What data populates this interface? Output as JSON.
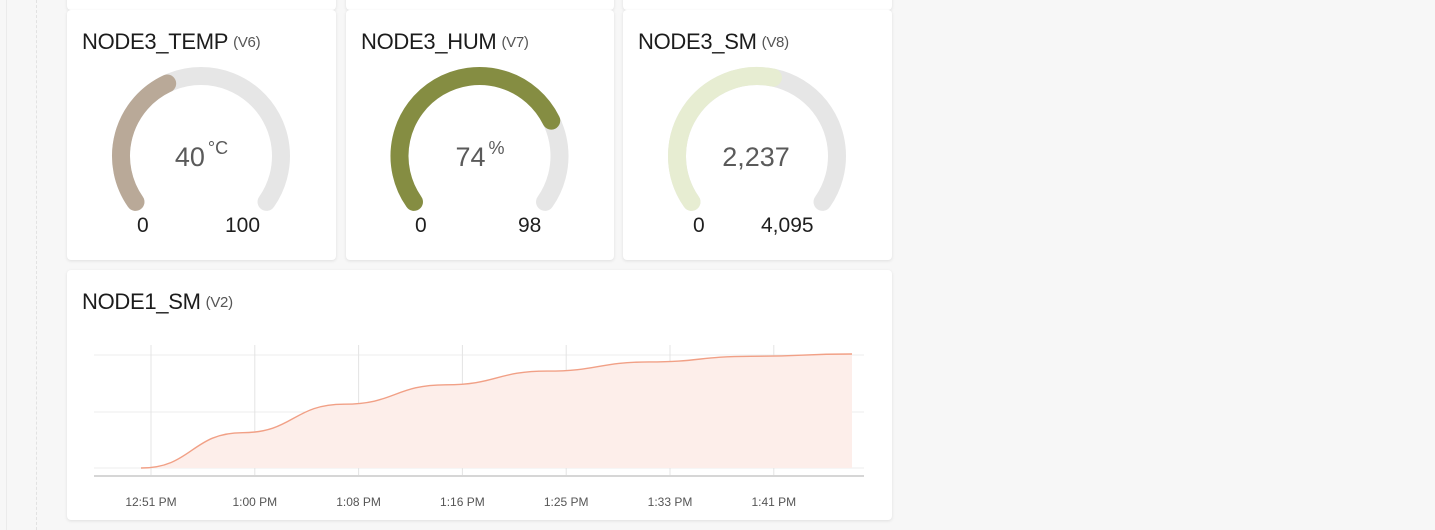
{
  "gauges": [
    {
      "title": "NODE3_TEMP",
      "pin": "(V6)",
      "value_text": "40",
      "unit": "°C",
      "min": "0",
      "max": "100",
      "fraction": 0.4,
      "color": "#b9a998"
    },
    {
      "title": "NODE3_HUM",
      "pin": "(V7)",
      "value_text": "74",
      "unit": "%",
      "min": "0",
      "max": "98",
      "fraction": 0.755,
      "color": "#858d42"
    },
    {
      "title": "NODE3_SM",
      "pin": "(V8)",
      "value_text": "2,237",
      "unit": "",
      "min": "0",
      "max": "4,095",
      "fraction": 0.546,
      "color": "#e7edd2"
    }
  ],
  "chart": {
    "title": "NODE1_SM",
    "pin": "(V2)",
    "line_color": "#f1a086",
    "fill_color": "#fdeeea"
  },
  "chart_data": {
    "type": "area",
    "title": "NODE1_SM",
    "xlabel": "",
    "ylabel": "",
    "x_ticks": [
      "12:51 PM",
      "1:00 PM",
      "1:08 PM",
      "1:16 PM",
      "1:25 PM",
      "1:33 PM",
      "1:41 PM"
    ],
    "x": [
      "12:51 PM",
      "1:00 PM",
      "1:08 PM",
      "1:16 PM",
      "1:25 PM",
      "1:33 PM",
      "1:41 PM",
      "1:48 PM"
    ],
    "series": [
      {
        "values": [
          0.0,
          0.31,
          0.56,
          0.73,
          0.85,
          0.93,
          0.98,
          1.0
        ]
      }
    ],
    "ylim": [
      0,
      1
    ],
    "grid": true,
    "legend": "none"
  }
}
